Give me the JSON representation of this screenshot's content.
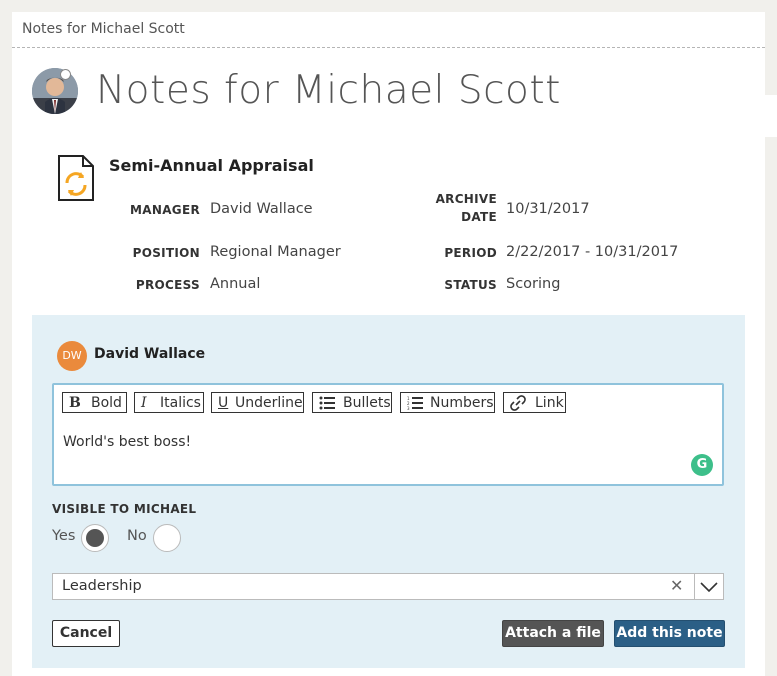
{
  "breadcrumb": "Notes for Michael Scott",
  "page_title": "Notes for Michael Scott",
  "review": {
    "title": "Semi-Annual Appraisal",
    "manager_label": "MANAGER",
    "manager_value": "David Wallace",
    "position_label": "POSITION",
    "position_value": "Regional Manager",
    "process_label": "PROCESS",
    "process_value": "Annual",
    "archive_label_1": "ARCHIVE",
    "archive_label_2": "DATE",
    "archive_value": "10/31/2017",
    "period_label": "PERIOD",
    "period_value": "2/22/2017 - 10/31/2017",
    "status_label": "STATUS",
    "status_value": "Scoring"
  },
  "note": {
    "author_initials": "DW",
    "author_name": "David Wallace",
    "toolbar": {
      "bold": "Bold",
      "italics": "Italics",
      "underline": "Underline",
      "bullets": "Bullets",
      "numbers": "Numbers",
      "link": "Link"
    },
    "text": "World's best boss!",
    "visible_label": "VISIBLE TO MICHAEL",
    "yes_label": "Yes",
    "no_label": "No",
    "visible_selected": "Yes",
    "category_value": "Leadership",
    "cancel_label": "Cancel",
    "attach_label": "Attach a file",
    "add_label": "Add this note"
  },
  "colors": {
    "panel": "#e3f0f6",
    "primary_button": "#2b5f86",
    "author_badge": "#ea8a3c",
    "doc_icon_accent": "#f5a623"
  }
}
